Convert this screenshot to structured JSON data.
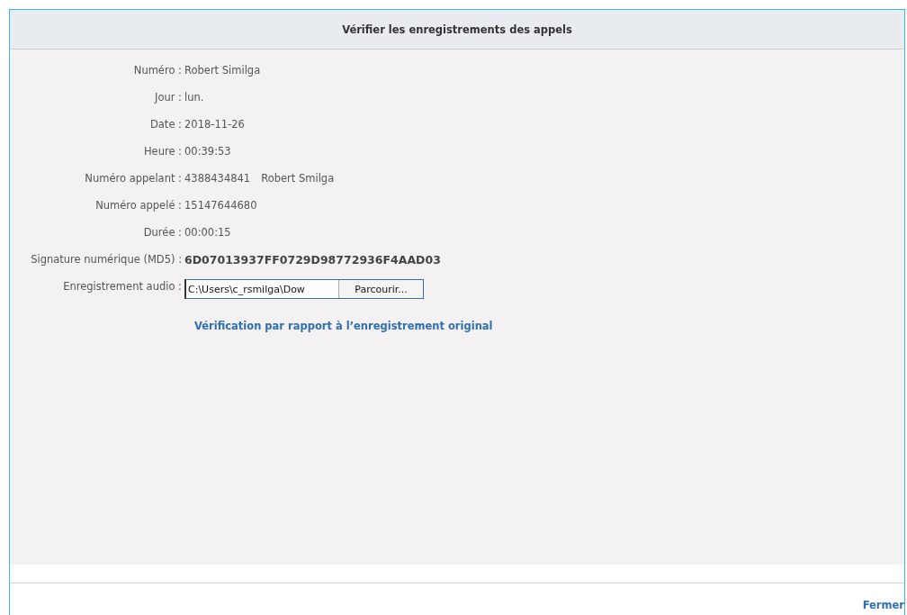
{
  "window": {
    "title": "Vérifier les enregistrements des appels"
  },
  "fields": [
    {
      "label": "Numéro :",
      "value": "Robert Similga"
    },
    {
      "label": "Jour :",
      "value": "lun."
    },
    {
      "label": "Date :",
      "value": "2018-11-26"
    },
    {
      "label": "Heure :",
      "value": "00:39:53"
    },
    {
      "label": "Numéro appelant :",
      "value": "4388434841",
      "extra": "Robert Smilga"
    },
    {
      "label": "Numéro appelé :",
      "value": "15147644680"
    },
    {
      "label": "Durée :",
      "value": "00:00:15"
    },
    {
      "label": "Signature numérique (MD5) :",
      "value": "6D07013937FF0729D98772936F4AAD03",
      "bold": true
    }
  ],
  "audio": {
    "label": "Enregistrement audio :",
    "value": "C:\\Users\\c_rsmilga\\Dow",
    "button": "Parcourir..."
  },
  "verify_link": "Vérification par rapport à l’enregistrement original",
  "close_link": "Fermer"
}
